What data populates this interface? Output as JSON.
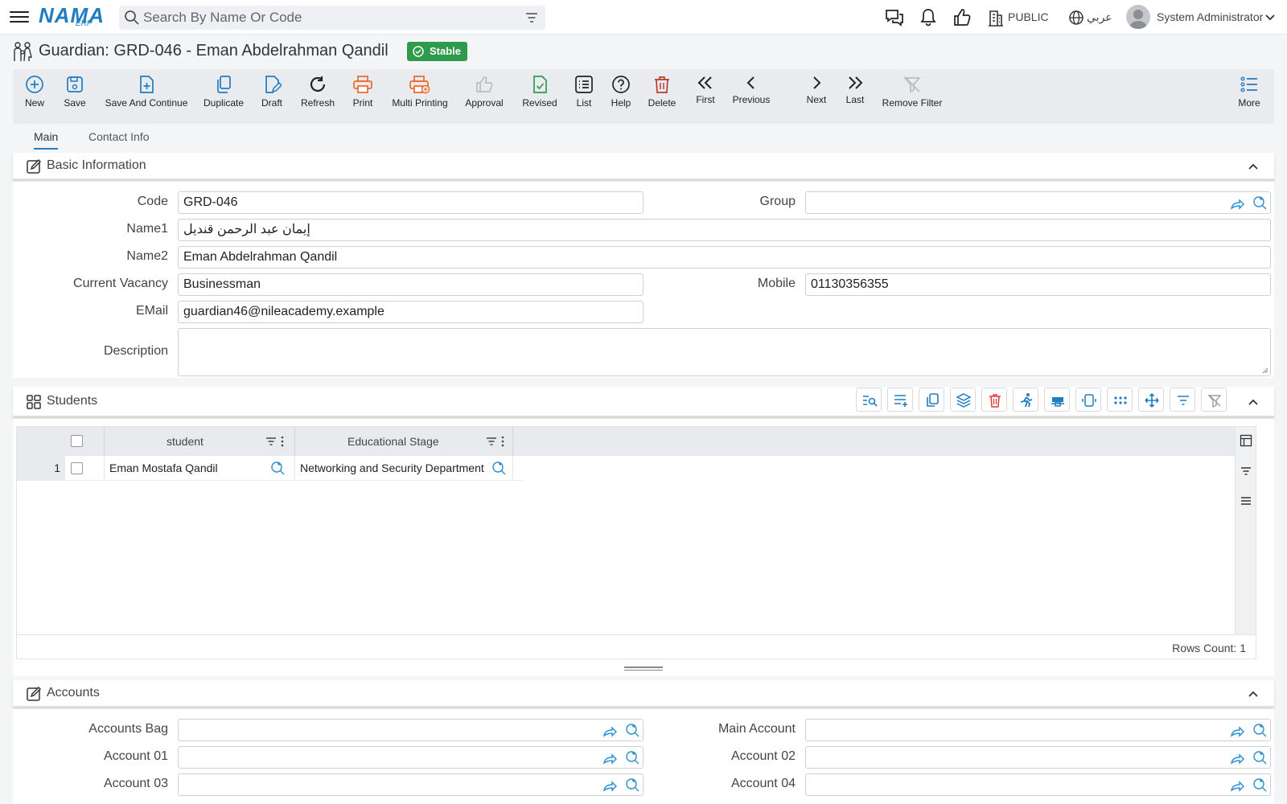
{
  "app": {
    "logo_main": "NAMA",
    "logo_sub": "ERP"
  },
  "search": {
    "placeholder": "Search By Name Or Code"
  },
  "header": {
    "branch": "PUBLIC",
    "language": "عربي",
    "user": "System Administrator"
  },
  "page": {
    "title": "Guardian: GRD-046 - Eman Abdelrahman Qandil",
    "status": "Stable"
  },
  "toolbar": {
    "new": "New",
    "save": "Save",
    "save_continue": "Save And Continue",
    "duplicate": "Duplicate",
    "draft": "Draft",
    "refresh": "Refresh",
    "print": "Print",
    "multi_printing": "Multi Printing",
    "approval": "Approval",
    "revised": "Revised",
    "list": "List",
    "help": "Help",
    "delete": "Delete",
    "first": "First",
    "previous": "Previous",
    "next": "Next",
    "last": "Last",
    "remove_filter": "Remove Filter",
    "more": "More"
  },
  "tabs": {
    "main": "Main",
    "contact": "Contact Info"
  },
  "basic": {
    "title": "Basic Information",
    "code_label": "Code",
    "code": "GRD-046",
    "group_label": "Group",
    "group": "",
    "name1_label": "Name1",
    "name1": "إيمان عبد الرحمن قنديل",
    "name2_label": "Name2",
    "name2": "Eman Abdelrahman Qandil",
    "vacancy_label": "Current Vacancy",
    "vacancy": "Businessman",
    "mobile_label": "Mobile",
    "mobile": "01130356355",
    "email_label": "EMail",
    "email": "guardian46@nileacademy.example",
    "description_label": "Description",
    "description": ""
  },
  "students": {
    "title": "Students",
    "columns": [
      "student",
      "Educational Stage"
    ],
    "rows": [
      {
        "num": "1",
        "student": "Eman Mostafa Qandil",
        "stage": "Networking and Security Department"
      }
    ],
    "rows_count": "Rows Count: 1"
  },
  "accounts": {
    "title": "Accounts",
    "accounts_bag": "Accounts Bag",
    "main_account": "Main Account",
    "account01": "Account 01",
    "account02": "Account 02",
    "account03": "Account 03",
    "account04": "Account 04"
  },
  "colors": {
    "brand": "#1f7dc1",
    "status": "#2e9a4b",
    "print": "#e8692a",
    "delete": "#c0392b"
  }
}
